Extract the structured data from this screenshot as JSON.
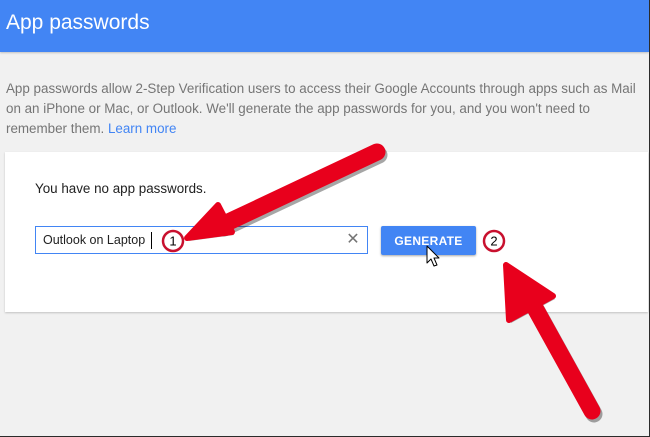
{
  "header": {
    "title": "App passwords",
    "background": "#4285f4"
  },
  "description": {
    "text": "App passwords allow 2-Step Verification users to access their Google Accounts through apps such as Mail on an iPhone or Mac, or Outlook. We'll generate the app passwords for you, and you won't need to remember them.",
    "learn_more": "Learn more"
  },
  "card": {
    "empty_message": "You have no app passwords.",
    "name_input": {
      "value": "Outlook on Laptop",
      "clear_icon": "close-icon"
    },
    "generate_label": "GENERATE"
  },
  "annotations": {
    "step_1": "1",
    "step_2": "2",
    "arrow_color": "#e8001c",
    "badge_color": "#c8102e"
  }
}
